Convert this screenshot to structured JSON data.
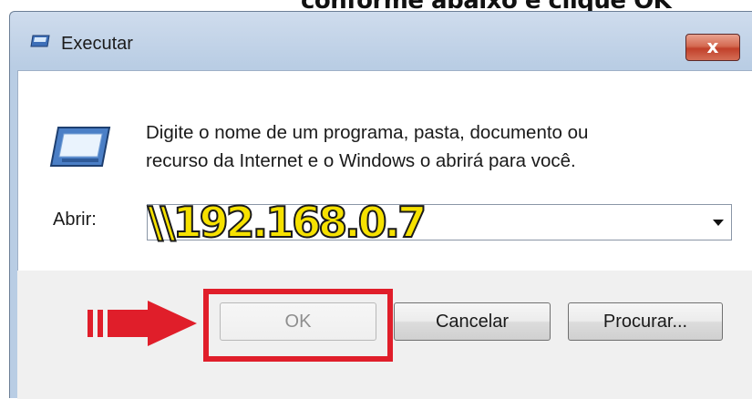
{
  "caption": "conforme abaixo e clique OK",
  "window": {
    "title": "Executar",
    "close_label": "x"
  },
  "content": {
    "description_line1": "Digite o nome de um programa, pasta, documento ou",
    "description_line2": "recurso da Internet e o Windows o abrirá para você.",
    "open_label": "Abrir:",
    "open_value": "\\\\192.168.0.7"
  },
  "buttons": {
    "ok": "OK",
    "cancel": "Cancelar",
    "browse": "Procurar..."
  },
  "colors": {
    "highlight": "#e01e2a",
    "overlay_text": "#f6e100"
  }
}
